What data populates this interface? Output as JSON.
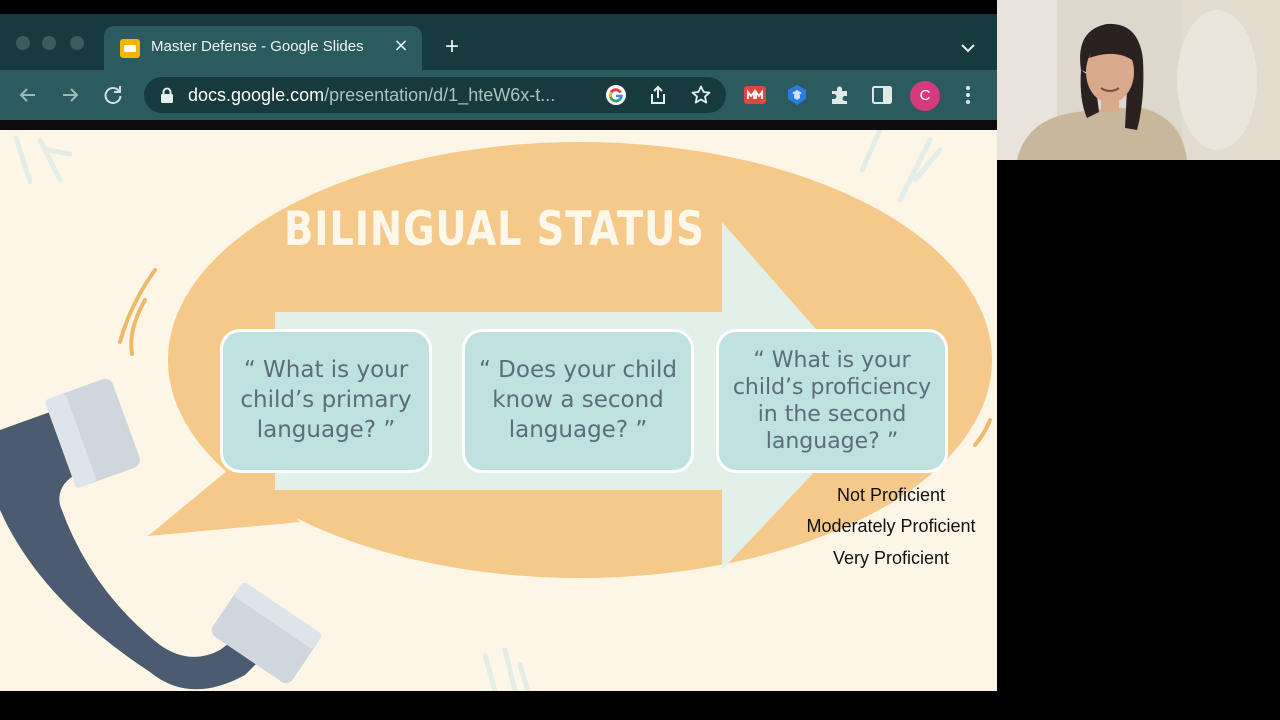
{
  "browser": {
    "tab": {
      "title": "Master Defense - Google Slides",
      "close_label": "×"
    },
    "new_tab_label": "+",
    "address_bar": {
      "host": "docs.google.com",
      "path": "/presentation/d/1_hteW6x-t..."
    },
    "profile_initial": "C",
    "icons": [
      "back-icon",
      "forward-icon",
      "reload-icon",
      "lock-icon",
      "google-lens-icon",
      "share-icon",
      "bookmark-star-icon",
      "extension-red-icon",
      "extension-blue-icon",
      "extensions-puzzle-icon",
      "side-panel-icon",
      "menu-icon"
    ]
  },
  "slide": {
    "title": "BILINGUAL STATUS",
    "questions": [
      "“ What is your child’s primary language? ”",
      "“ Does your child know a second language? ”",
      "“ What is your child’s proficiency in the second language? ”"
    ],
    "proficiency_levels": [
      "Not Proficient",
      "Moderately Proficient",
      "Very Proficient"
    ]
  },
  "colors": {
    "tab_bar": "#163a3d",
    "toolbar": "#2b5a5f",
    "slide_bg": "#fdf6e6",
    "bubble": "#f4c98a",
    "arrow": "#e3f0ea",
    "question_box": "#bfe2e1",
    "phone": "#4b5c70"
  }
}
